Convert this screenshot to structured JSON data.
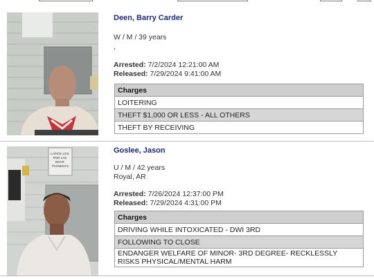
{
  "records": [
    {
      "name": "Deen, Barry Carder",
      "demographics": "W / M / 39 years",
      "location": ",",
      "arrested_label": "Arrested:",
      "arrested": "7/2/2024 12:21:00 AM",
      "released_label": "Released:",
      "released": "7/29/2024 9:41:00 AM",
      "charges_header": "Charges",
      "charges": [
        "LOITERING",
        "THEFT $1,000 OR LESS - ALL OTHERS",
        "THEFT BY RECEIVING"
      ]
    },
    {
      "name": "Goslee, Jason",
      "demographics": "U / M / 42 years",
      "location": "Royal, AR",
      "arrested_label": "Arrested:",
      "arrested": "7/26/2024 12:37:00 PM",
      "released_label": "Released:",
      "released": "7/29/2024 4:31:00 PM",
      "charges_header": "Charges",
      "charges": [
        "DRIVING WHILE INTOXICATED - DWI 3RD",
        "FOLLOWING TO CLOSE",
        "ENDANGER WELFARE OF MINOR- 3RD DEGREE- RECKLESSLY RISKS PHYSICAL/MENTAL HARM"
      ]
    }
  ],
  "photo2_sign_text": "LAPICE LOS\nPOR LAS\nBOAR\nPAYMENTS",
  "colors": {
    "name": "#1a2a78",
    "header_bg": "#cfcfcf",
    "alt_row": "#d6d6d6"
  }
}
